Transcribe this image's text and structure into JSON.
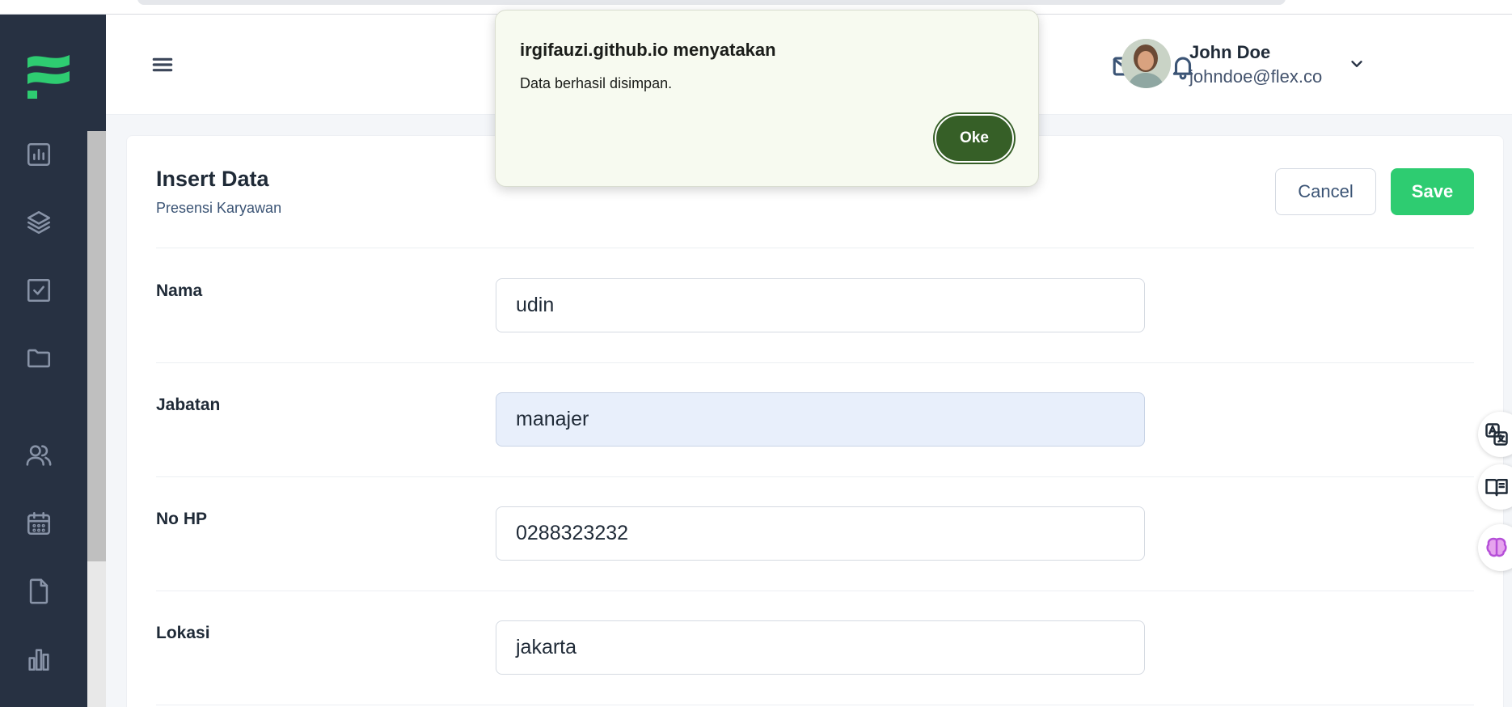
{
  "dialog": {
    "title": "irgifauzi.github.io menyatakan",
    "message": "Data berhasil disimpan.",
    "ok_label": "Oke"
  },
  "header": {
    "user": {
      "name": "John Doe",
      "email": "johndoe@flex.co"
    }
  },
  "sidebar": {
    "items": [
      {
        "icon": "chart-icon"
      },
      {
        "icon": "layers-icon"
      },
      {
        "icon": "checkbox-icon"
      },
      {
        "icon": "folder-icon"
      },
      {
        "icon": "users-icon"
      },
      {
        "icon": "calendar-icon"
      },
      {
        "icon": "file-icon"
      },
      {
        "icon": "bar-chart-icon"
      }
    ]
  },
  "form": {
    "title": "Insert Data",
    "subtitle": "Presensi Karyawan",
    "cancel_label": "Cancel",
    "save_label": "Save",
    "fields": [
      {
        "label": "Nama",
        "value": "udin"
      },
      {
        "label": "Jabatan",
        "value": "manajer"
      },
      {
        "label": "No HP",
        "value": "0288323232"
      },
      {
        "label": "Lokasi",
        "value": "jakarta"
      }
    ]
  },
  "colors": {
    "sidebar": "#273142",
    "accent": "#2ecc71",
    "dialog_button": "#365f27",
    "dialog_bg": "#f7faf0"
  },
  "floating_tools": [
    "translate-icon",
    "reader-icon",
    "brain-icon"
  ]
}
